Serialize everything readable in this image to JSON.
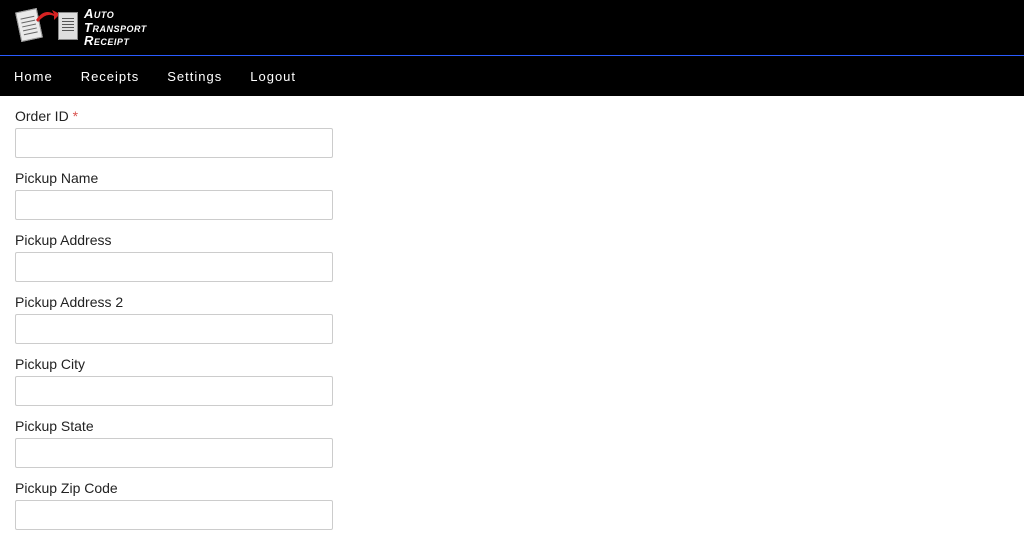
{
  "brand": {
    "line1": "Auto",
    "line2": "Transport",
    "line3": "Receipt"
  },
  "nav": {
    "home": "Home",
    "receipts": "Receipts",
    "settings": "Settings",
    "logout": "Logout"
  },
  "form": {
    "order_id": {
      "label": "Order ID",
      "value": "",
      "required": true
    },
    "pickup_name": {
      "label": "Pickup Name",
      "value": ""
    },
    "pickup_address": {
      "label": "Pickup Address",
      "value": ""
    },
    "pickup_address_2": {
      "label": "Pickup Address 2",
      "value": ""
    },
    "pickup_city": {
      "label": "Pickup City",
      "value": ""
    },
    "pickup_state": {
      "label": "Pickup State",
      "value": ""
    },
    "pickup_zip": {
      "label": "Pickup Zip Code",
      "value": ""
    }
  }
}
